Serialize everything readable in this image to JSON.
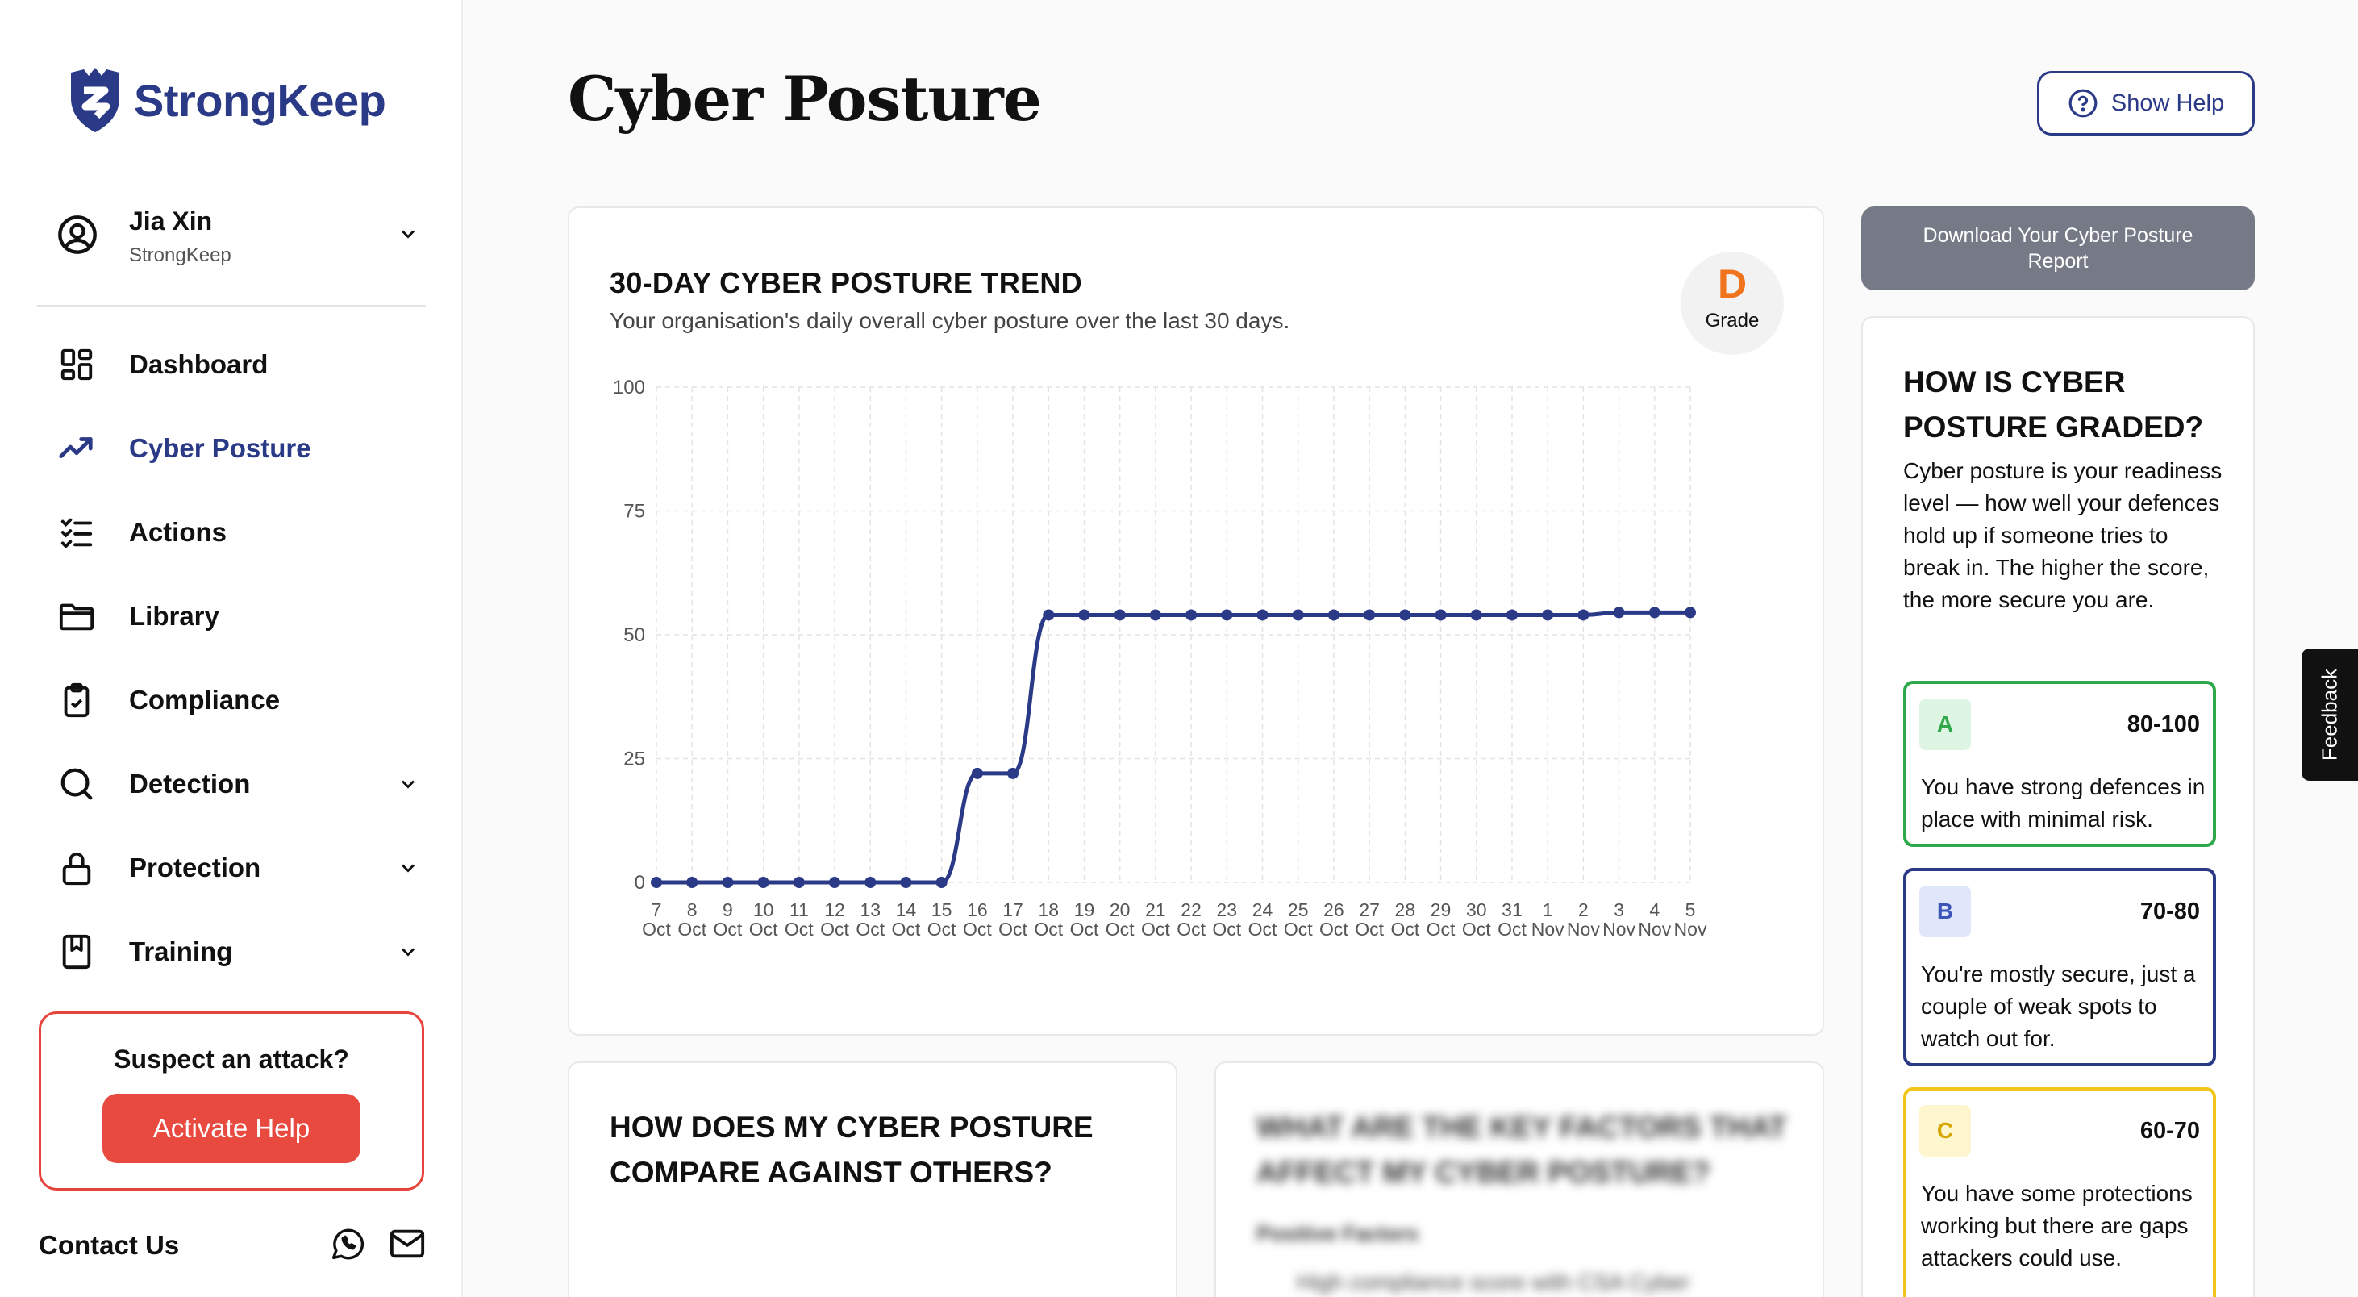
{
  "brand": {
    "name": "StrongKeep",
    "color": "#2b3a86"
  },
  "user": {
    "name": "Jia Xin",
    "org": "StrongKeep"
  },
  "nav": [
    {
      "label": "Dashboard",
      "icon": "dashboard-icon",
      "active": false,
      "expandable": false
    },
    {
      "label": "Cyber Posture",
      "icon": "trend-icon",
      "active": true,
      "expandable": false
    },
    {
      "label": "Actions",
      "icon": "checklist-icon",
      "active": false,
      "expandable": false
    },
    {
      "label": "Library",
      "icon": "folder-icon",
      "active": false,
      "expandable": false
    },
    {
      "label": "Compliance",
      "icon": "clipboard-check-icon",
      "active": false,
      "expandable": false
    },
    {
      "label": "Detection",
      "icon": "search-icon",
      "active": false,
      "expandable": true
    },
    {
      "label": "Protection",
      "icon": "lock-icon",
      "active": false,
      "expandable": true
    },
    {
      "label": "Training",
      "icon": "bookmark-icon",
      "active": false,
      "expandable": true
    }
  ],
  "attack": {
    "title": "Suspect an attack?",
    "button": "Activate Help",
    "color": "#e94a3f"
  },
  "contact": {
    "label": "Contact Us"
  },
  "page": {
    "title": "Cyber Posture",
    "help_button": "Show Help"
  },
  "trend": {
    "title": "30-DAY CYBER POSTURE TREND",
    "subtitle": "Your organisation's daily overall cyber posture over the last 30 days.",
    "grade": "D",
    "grade_label": "Grade",
    "grade_color": "#f0731e"
  },
  "chart_data": {
    "type": "line",
    "x": [
      [
        "7",
        "Oct"
      ],
      [
        "8",
        "Oct"
      ],
      [
        "9",
        "Oct"
      ],
      [
        "10",
        "Oct"
      ],
      [
        "11",
        "Oct"
      ],
      [
        "12",
        "Oct"
      ],
      [
        "13",
        "Oct"
      ],
      [
        "14",
        "Oct"
      ],
      [
        "15",
        "Oct"
      ],
      [
        "16",
        "Oct"
      ],
      [
        "17",
        "Oct"
      ],
      [
        "18",
        "Oct"
      ],
      [
        "19",
        "Oct"
      ],
      [
        "20",
        "Oct"
      ],
      [
        "21",
        "Oct"
      ],
      [
        "22",
        "Oct"
      ],
      [
        "23",
        "Oct"
      ],
      [
        "24",
        "Oct"
      ],
      [
        "25",
        "Oct"
      ],
      [
        "26",
        "Oct"
      ],
      [
        "27",
        "Oct"
      ],
      [
        "28",
        "Oct"
      ],
      [
        "29",
        "Oct"
      ],
      [
        "30",
        "Oct"
      ],
      [
        "31",
        "Oct"
      ],
      [
        "1",
        "Nov"
      ],
      [
        "2",
        "Nov"
      ],
      [
        "3",
        "Nov"
      ],
      [
        "4",
        "Nov"
      ],
      [
        "5",
        "Nov"
      ]
    ],
    "values": [
      0,
      0,
      0,
      0,
      0,
      0,
      0,
      0,
      0,
      22,
      22,
      54,
      54,
      54,
      54,
      54,
      54,
      54,
      54,
      54,
      54,
      54,
      54,
      54,
      54,
      54,
      54,
      54.5,
      54.5,
      54.5
    ],
    "yticks": [
      0,
      25,
      50,
      75,
      100
    ],
    "ylim": [
      0,
      100
    ],
    "line_color": "#2b3a86",
    "grid": true
  },
  "download": {
    "label": "Download Your Cyber Posture Report"
  },
  "grading": {
    "title": "HOW IS CYBER POSTURE GRADED?",
    "text": "Cyber posture is your readiness level — how well your defences hold up if someone tries to break in. The higher the score, the more secure you are.",
    "tiers": [
      {
        "grade": "A",
        "range": "80-100",
        "desc": "You have strong defences in place with minimal risk.",
        "border": "#2ea84a",
        "bg": "#dff5e3",
        "fg": "#2ea84a"
      },
      {
        "grade": "B",
        "range": "70-80",
        "desc": "You're mostly secure, just a couple of weak spots to watch out for.",
        "border": "#2b3a86",
        "bg": "#e0e7fb",
        "fg": "#3b55b8"
      },
      {
        "grade": "C",
        "range": "60-70",
        "desc": "You have some protections working but there are gaps attackers could use.",
        "border": "#f0c419",
        "bg": "#fdf6cf",
        "fg": "#d6a700"
      }
    ]
  },
  "compare": {
    "title": "HOW DOES MY CYBER POSTURE COMPARE AGAINST OTHERS?"
  },
  "factors": {
    "title": "WHAT ARE THE KEY FACTORS THAT AFFECT MY CYBER POSTURE?",
    "positive_label": "Positive Factors",
    "item": "High compliance score with CSA Cyber"
  },
  "feedback": {
    "label": "Feedback"
  }
}
